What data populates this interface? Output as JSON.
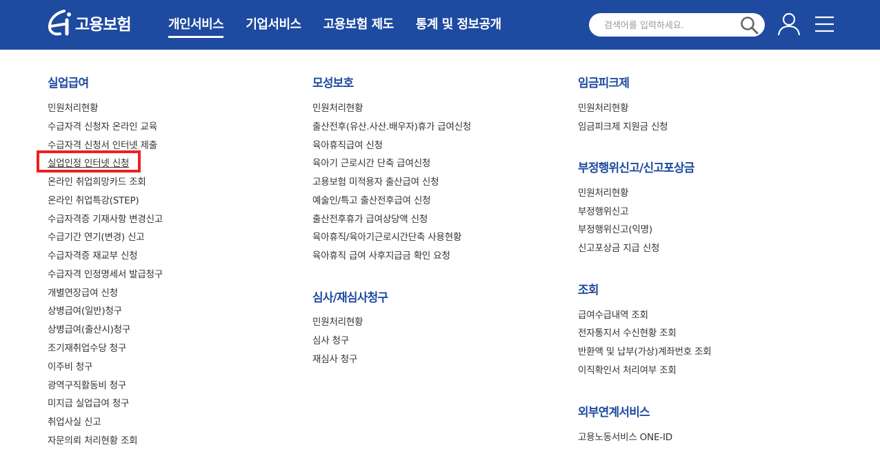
{
  "header": {
    "logo_text": "고용보험",
    "nav": [
      {
        "label": "개인서비스",
        "active": true
      },
      {
        "label": "기업서비스",
        "active": false
      },
      {
        "label": "고용보험 제도",
        "active": false
      },
      {
        "label": "통계 및 정보공개",
        "active": false
      }
    ],
    "search_placeholder": "검색어를 입력하세요.",
    "icons": [
      "search-icon",
      "user-icon",
      "menu-icon"
    ]
  },
  "columns": [
    {
      "sections": [
        {
          "title": "실업급여",
          "links": [
            "민원처리현황",
            "수급자격 신청자 온라인 교육",
            "수급자격 신청서 인터넷 제출",
            "실업인정 인터넷 신청",
            "온라인 취업희망카드 조회",
            "온라인 취업특강(STEP)",
            "수급자격증 기재사항 변경신고",
            "수급기간 연기(변경) 신고",
            "수급자격증 재교부 신청",
            "수급자격 인정명세서 발급청구",
            "개별연장급여 신청",
            "상병급여(일반)청구",
            "상병급여(출산시)청구",
            "조기재취업수당 청구",
            "이주비 청구",
            "광역구직활동비 청구",
            "미지급 실업급여 청구",
            "취업사실 신고",
            "자문의뢰 처리현황 조회"
          ]
        }
      ]
    },
    {
      "sections": [
        {
          "title": "모성보호",
          "links": [
            "민원처리현황",
            "출산전후(유산.사산.배우자)휴가 급여신청",
            "육아휴직급여 신청",
            "육아기 근로시간 단축 급여신청",
            "고용보험 미적용자 출산급여 신청",
            "예술인/특고 출산전후급여 신청",
            "출산전후휴가 급여상당액 신청",
            "육아휴직/육아기근로시간단축 사용현황",
            "육아휴직 급여 사후지급금 확인 요청"
          ]
        },
        {
          "title": "심사/재심사청구",
          "links": [
            "민원처리현황",
            "심사 청구",
            "재심사 청구"
          ]
        }
      ]
    },
    {
      "sections": [
        {
          "title": "임금피크제",
          "links": [
            "민원처리현황",
            "임금피크제 지원금 신청"
          ]
        },
        {
          "title": "부정행위신고/신고포상금",
          "links": [
            "민원처리현황",
            "부정행위신고",
            "부정행위신고(익명)",
            "신고포상금 지급 신청"
          ]
        },
        {
          "title": "조회",
          "links": [
            "급여수급내역 조회",
            "전자통지서 수신현황 조회",
            "반환액 및 납부(가상)계좌번호 조회",
            "이직확인서 처리여부 조회"
          ]
        },
        {
          "title": "외부연계서비스",
          "links": [
            "고용노동서비스 ONE-ID"
          ]
        }
      ]
    }
  ],
  "highlight": {
    "color": "#ef1f1f",
    "target": "실업인정 인터넷 신청"
  },
  "colors": {
    "header_bg": "#1e4aa0",
    "section_title": "#1e4aa0",
    "link_text": "#333333"
  }
}
